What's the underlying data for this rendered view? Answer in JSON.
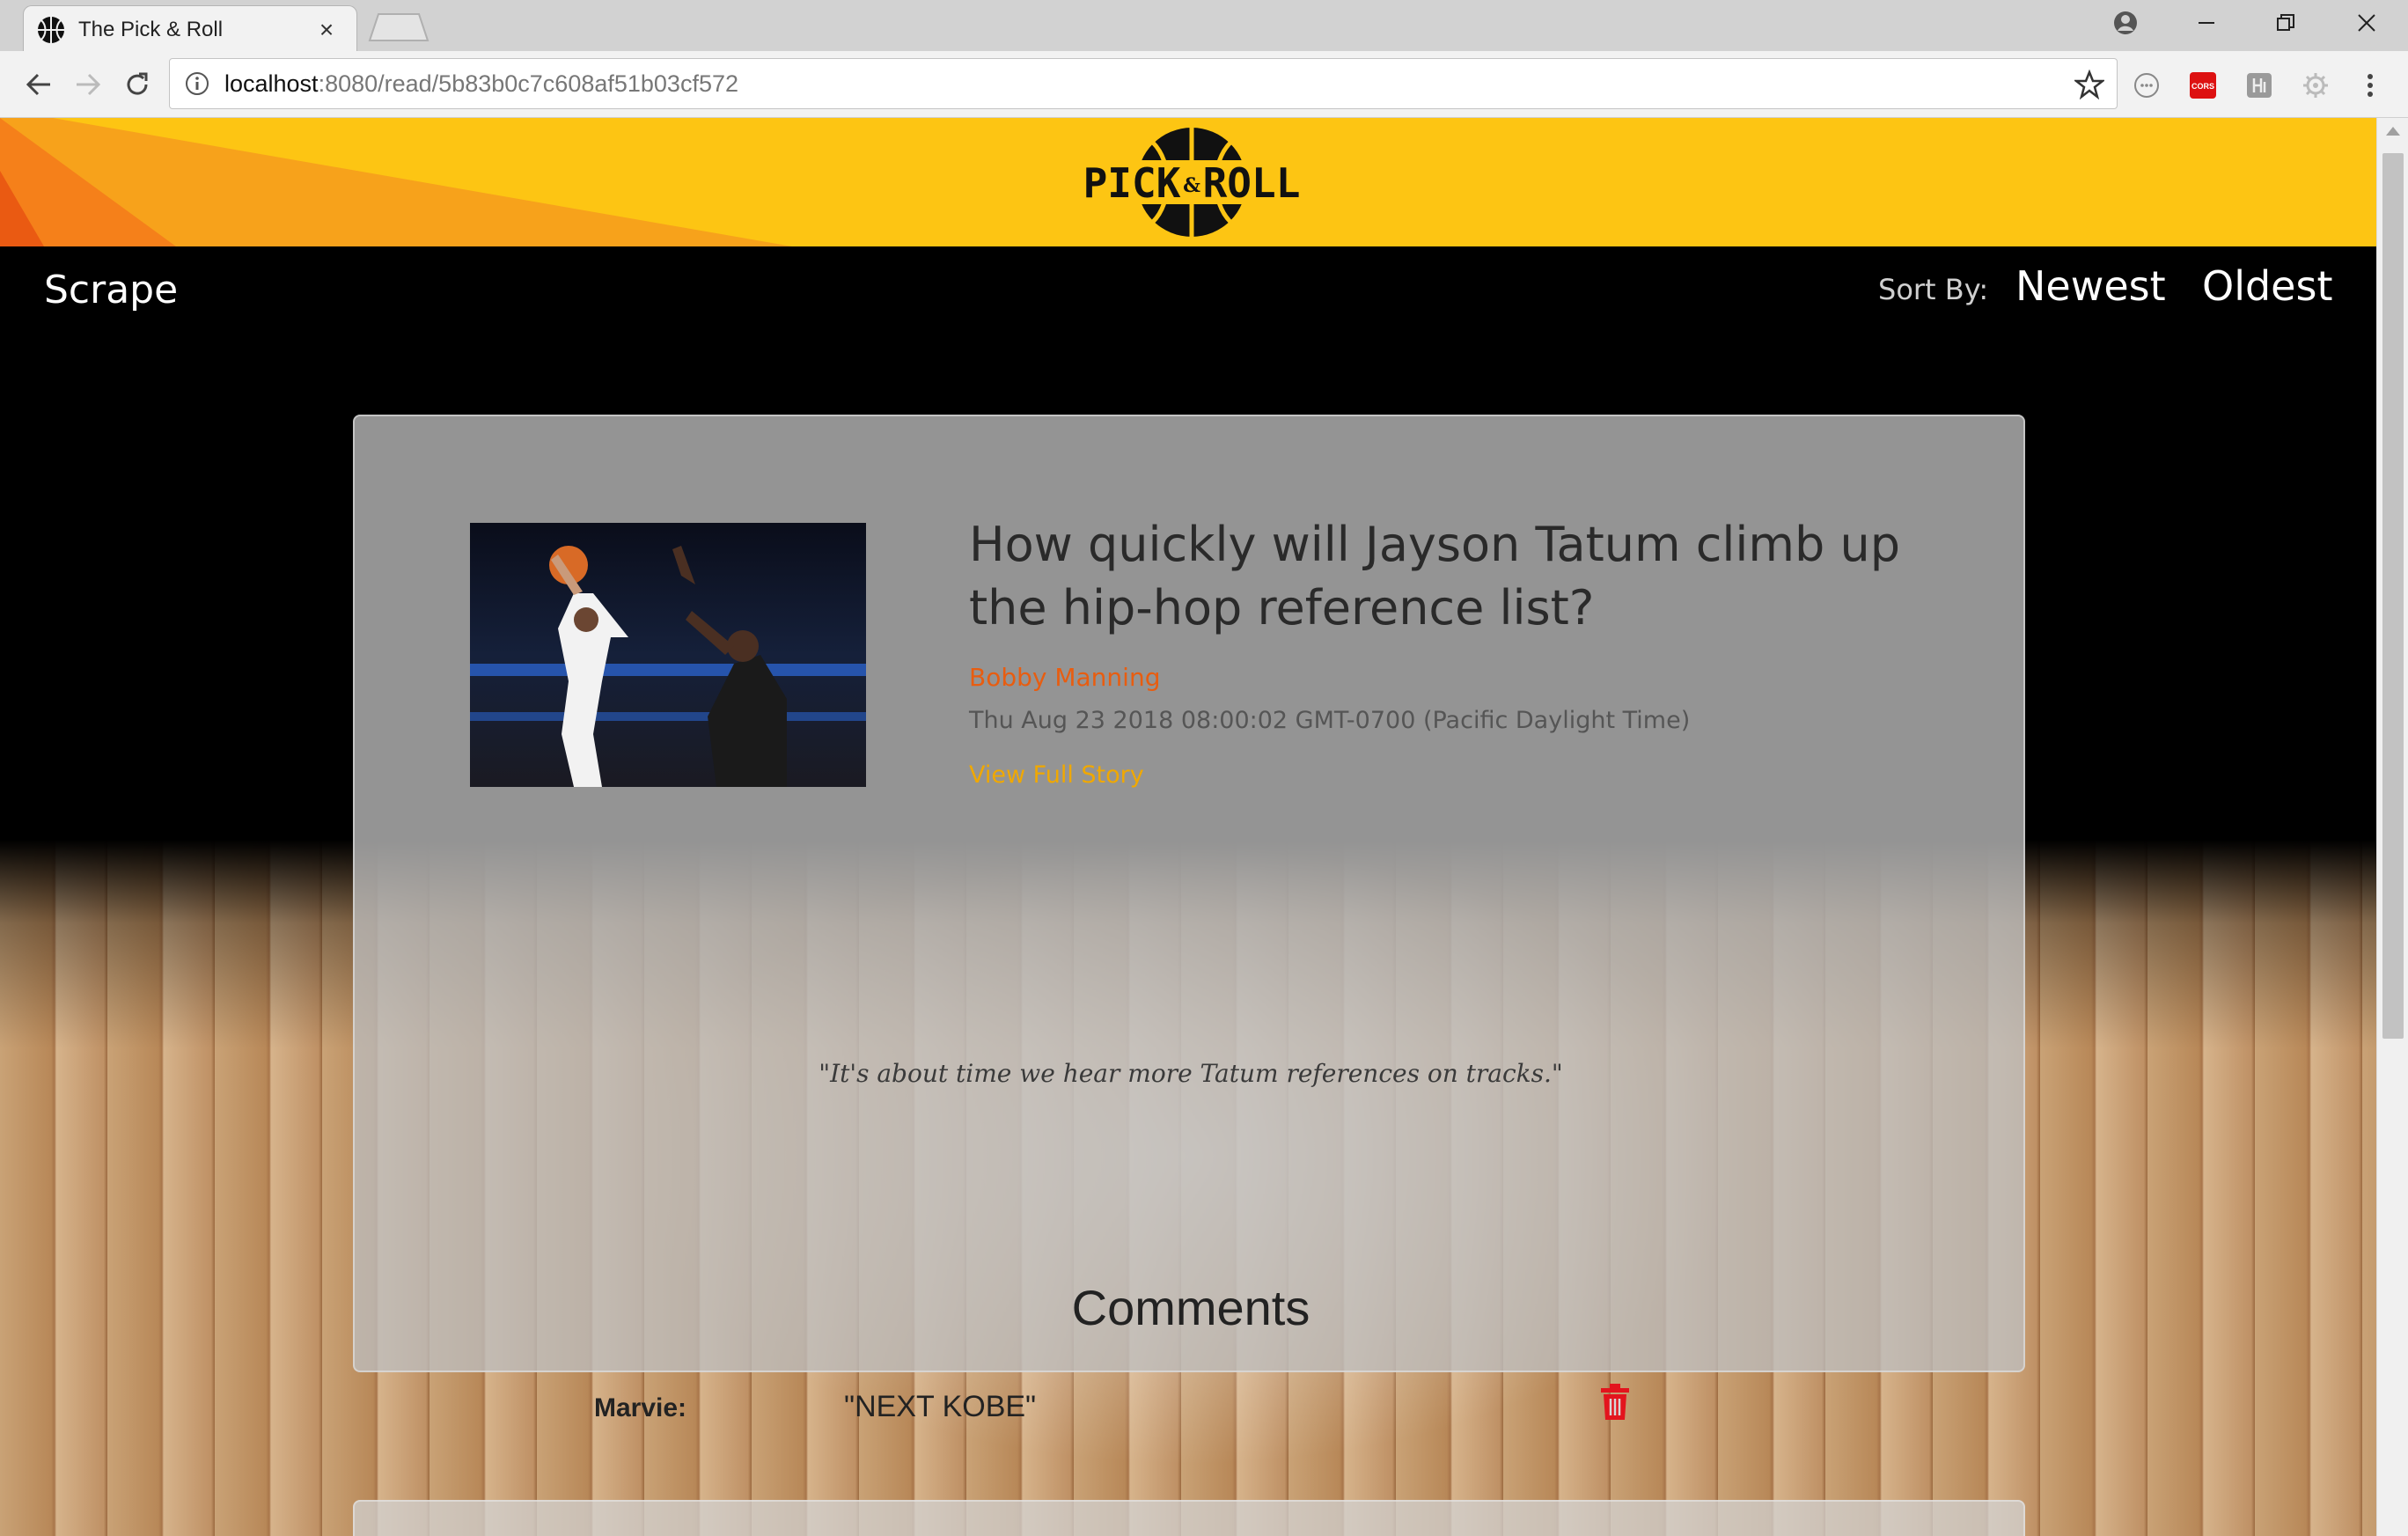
{
  "browser": {
    "tab_title": "The Pick & Roll",
    "tab_close": "×",
    "url_host": "localhost",
    "url_path": ":8080/read/5b83b0c7c608af51b03cf572"
  },
  "header": {
    "logo_text_left": "PICK",
    "logo_text_amp": "&",
    "logo_text_right": "ROLL",
    "brand_color": "#fdc513"
  },
  "nav": {
    "scrape_label": "Scrape",
    "sort_label": "Sort By:",
    "newest_label": "Newest",
    "oldest_label": "Oldest"
  },
  "article": {
    "title": "How quickly will Jayson Tatum climb up the hip-hop reference list?",
    "author": "Bobby Manning",
    "date": "Thu Aug 23 2018 08:00:02 GMT-0700 (Pacific Daylight Time)",
    "link_label": "View Full Story",
    "quote": "\"It's about time we hear more Tatum references on tracks.\"",
    "author_color": "#e85d10",
    "link_color": "#f0a800"
  },
  "comments": {
    "title": "Comments",
    "items": [
      {
        "user": "Marvie:",
        "text": "\"NEXT KOBE\""
      }
    ]
  },
  "icons": {
    "delete": "trash-icon",
    "extension_badge": "CORS"
  }
}
